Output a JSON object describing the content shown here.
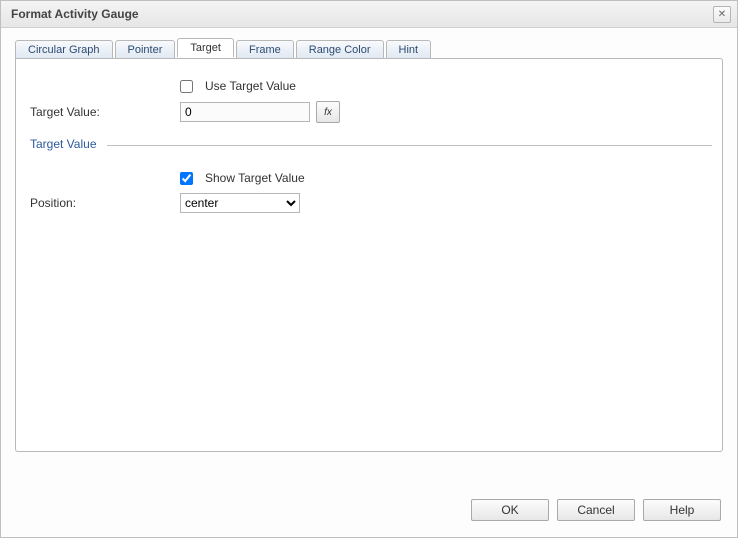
{
  "dialog": {
    "title": "Format Activity Gauge"
  },
  "tabs": {
    "circular_graph": "Circular Graph",
    "pointer": "Pointer",
    "target": "Target",
    "frame": "Frame",
    "range_color": "Range Color",
    "hint": "Hint",
    "active": "target"
  },
  "form": {
    "use_target_value": {
      "label": "Use Target Value",
      "checked": false
    },
    "target_value": {
      "label": "Target Value:",
      "value": "0",
      "fx": "fx"
    },
    "section_target_value": "Target Value",
    "show_target_value": {
      "label": "Show Target Value",
      "checked": true
    },
    "position": {
      "label": "Position:",
      "value": "center",
      "options": [
        "center"
      ]
    }
  },
  "buttons": {
    "ok": "OK",
    "cancel": "Cancel",
    "help": "Help"
  }
}
